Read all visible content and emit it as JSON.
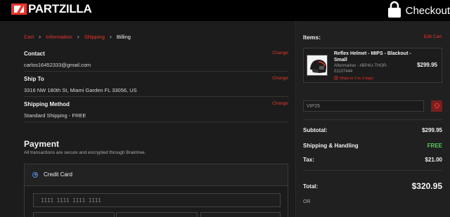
{
  "header": {
    "logo_text": "PARTZILLA",
    "checkout_label": "Checkout",
    "icons": [
      "logo-mark-icon",
      "lock-icon"
    ]
  },
  "breadcrumb": [
    {
      "label": "Cart",
      "current": false
    },
    {
      "label": "Information",
      "current": false
    },
    {
      "label": "Shipping",
      "current": false
    },
    {
      "label": "Billing",
      "current": true
    }
  ],
  "contact": {
    "title": "Contact",
    "value": "carlos16452333@gmail.com",
    "change_label": "Change"
  },
  "ship_to": {
    "title": "Ship To",
    "value": "3316 NW 180th St, Miami Garden FL 33056, US",
    "change_label": "Change"
  },
  "shipping_method": {
    "title": "Shipping Method",
    "value": "Standard Shipping - FREE",
    "change_label": "Change"
  },
  "payment": {
    "title": "Payment",
    "subtitle": "All transactions are secure and encrypted through Braintree.",
    "credit_card_label": "Credit Card",
    "card_number_placeholder": "1111 1111 1111 1111"
  },
  "order_summary": {
    "items_title": "Items:",
    "edit_cart_label": "Edit Cart",
    "item": {
      "name": "Reflex Helmet - MIPS - Blackout - Small",
      "sku": "Aftermarket - #BP4U-THOR-01107444",
      "ship_note": "Ships in 2 to 3 days",
      "price": "$299.95"
    },
    "promo_value": "VIP25",
    "subtotal_label": "Subtotal:",
    "subtotal_value": "$299.95",
    "shipping_label": "Shipping & Handling",
    "shipping_value": "FREE",
    "tax_label": "Tax:",
    "tax_value": "$21.00",
    "total_label": "Total:",
    "total_value": "$320.95",
    "or_label": "OR"
  },
  "colors": {
    "accent_red": "#e8352b",
    "free_green": "#3ddc4a",
    "radio_blue": "#4f8fe8",
    "background": "#1f1f1f",
    "header": "#000000"
  }
}
